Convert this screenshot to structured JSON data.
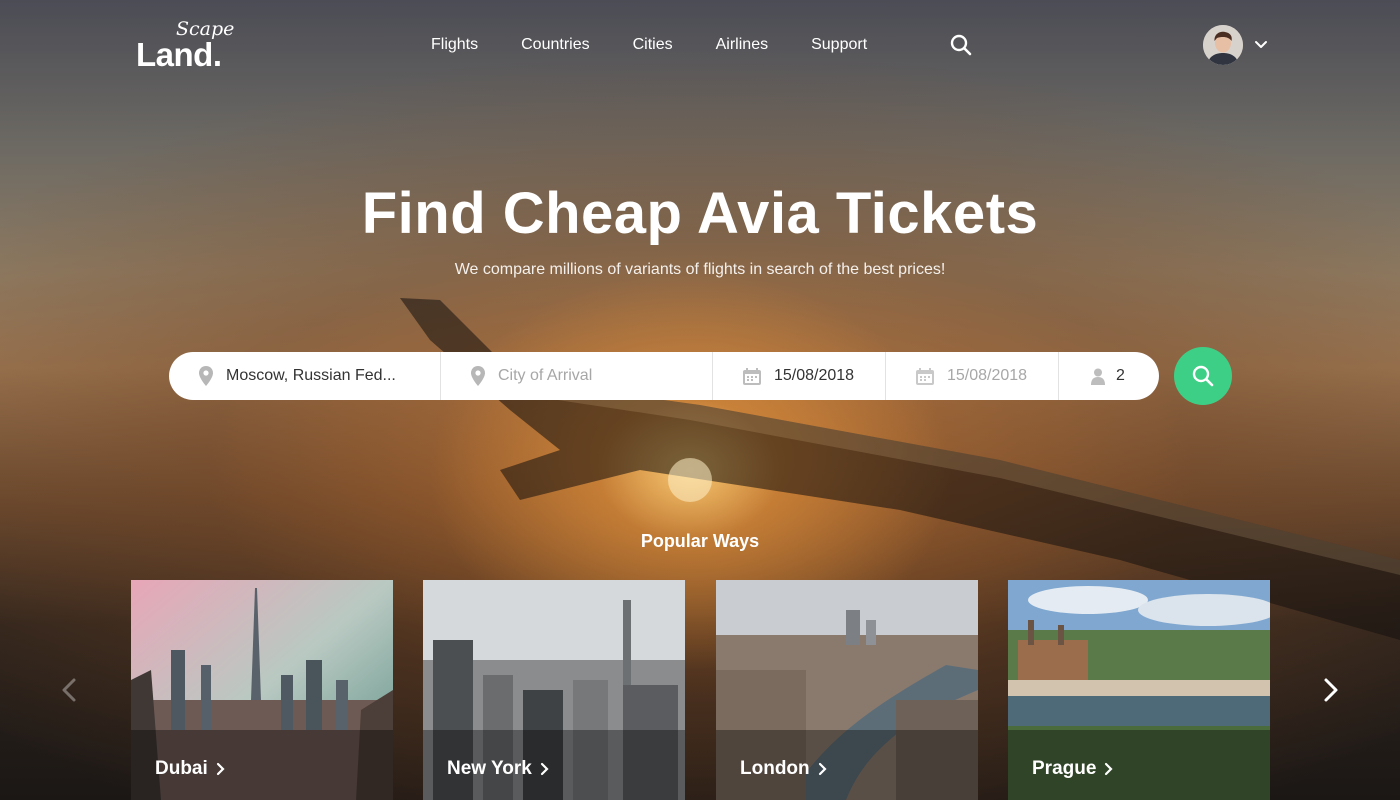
{
  "brand": {
    "logo_small": "Scape",
    "logo_big": "Land."
  },
  "nav": {
    "items": [
      "Flights",
      "Countries",
      "Cities",
      "Airlines",
      "Support"
    ]
  },
  "hero": {
    "title": "Find Cheap Avia Tickets",
    "subtitle": "We compare millions of variants of flights in search of the best prices!"
  },
  "search": {
    "from_value": "Moscow, Russian Fed...",
    "to_value": "",
    "to_placeholder": "City of Arrival",
    "depart_value": "15/08/2018",
    "return_value": "",
    "return_placeholder": "15/08/2018",
    "passengers_value": "2"
  },
  "popular": {
    "title": "Popular Ways",
    "cards": [
      "Dubai",
      "New York",
      "London",
      "Prague"
    ]
  },
  "colors": {
    "accent": "#3ecf86",
    "text_dark": "#333333",
    "placeholder": "#a7a7a7"
  },
  "icons": [
    "search-icon",
    "chevron-down-icon",
    "location-pin-icon",
    "calendar-icon",
    "person-icon",
    "chevron-left-icon",
    "chevron-right-icon"
  ]
}
